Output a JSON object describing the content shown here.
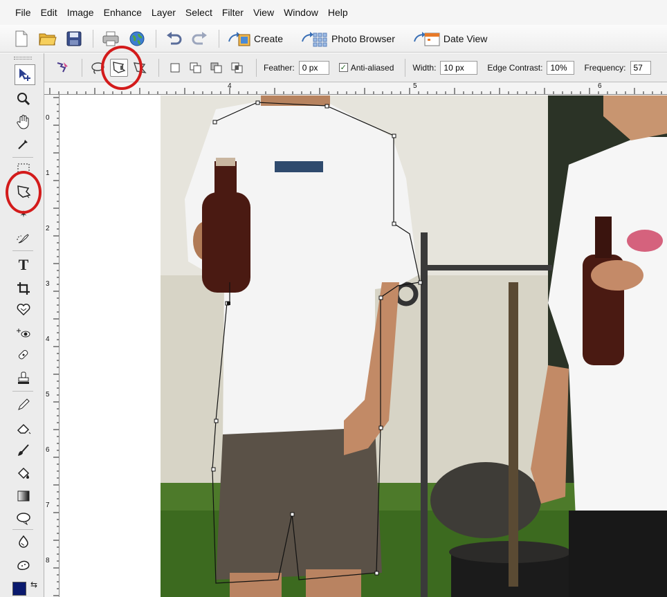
{
  "menubar": {
    "items": [
      "File",
      "Edit",
      "Image",
      "Enhance",
      "Layer",
      "Select",
      "Filter",
      "View",
      "Window",
      "Help"
    ]
  },
  "shortcuts": {
    "icons": [
      "new-document-icon",
      "open-folder-icon",
      "save-disk-icon",
      "print-icon",
      "online-services-globe-icon",
      "undo-icon",
      "redo-icon"
    ],
    "create_label": "Create",
    "photo_browser_label": "Photo Browser",
    "date_view_label": "Date View"
  },
  "options": {
    "feather_label": "Feather:",
    "feather_value": "0 px",
    "anti_aliased_label": "Anti-aliased",
    "anti_aliased_checked": true,
    "width_label": "Width:",
    "width_value": "10 px",
    "edge_contrast_label": "Edge Contrast:",
    "edge_contrast_value": "10%",
    "frequency_label": "Frequency:",
    "frequency_value": "57",
    "active_tool": "magnetic-lasso-icon"
  },
  "ruler": {
    "top_labels": [
      "4",
      "5",
      "6"
    ],
    "left_labels": [
      "0",
      "1",
      "2",
      "3",
      "4",
      "5",
      "6",
      "7",
      "8"
    ]
  },
  "colors": {
    "highlight_circle": "#d31b1b",
    "foreground_swatch": "#0b1a6e"
  }
}
